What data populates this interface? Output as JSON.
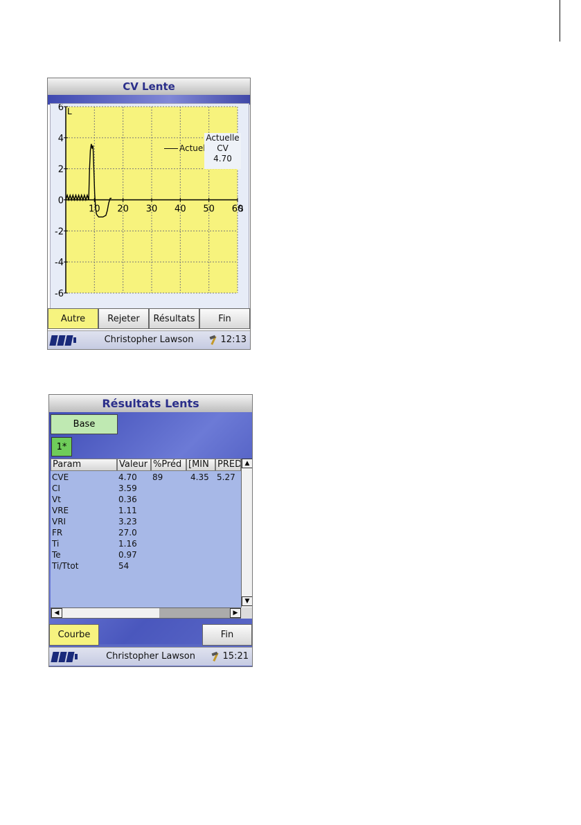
{
  "screen1": {
    "title": "CV Lente",
    "legend": {
      "series_label": "Actuell",
      "box_line1": "Actuelle",
      "box_line2": "CV",
      "box_value": "4.70"
    },
    "buttons": [
      "Autre",
      "Rejeter",
      "Résultats",
      "Fin"
    ],
    "active_button": "Autre",
    "status": {
      "user": "Christopher Lawson",
      "time": "12:13"
    }
  },
  "chart_data": {
    "type": "line",
    "y_unit": "L",
    "x_unit": "S",
    "xlim": [
      0,
      60
    ],
    "ylim": [
      -6,
      6
    ],
    "x_ticks": [
      10,
      20,
      30,
      40,
      50,
      60
    ],
    "y_ticks": [
      6,
      4,
      2,
      0,
      -2,
      -4,
      -6
    ],
    "x_tick_labels": [
      "10",
      "20",
      "30",
      "40",
      "50",
      "60"
    ],
    "y_tick_labels": [
      "6",
      "4",
      "2",
      "0",
      "-2",
      "-4",
      "-6"
    ],
    "grid": true,
    "legend_position": "top-right",
    "series": [
      {
        "name": "Actuell",
        "color": "#000000",
        "x": [
          0,
          0.5,
          1,
          1.5,
          2,
          2.5,
          3,
          3.5,
          4,
          4.5,
          5,
          5.5,
          6,
          6.5,
          7,
          7.5,
          8,
          8.3,
          8.6,
          8.9,
          9.2,
          9.5,
          9.8,
          10.1,
          10.4,
          10.7,
          11,
          11.5,
          12,
          13,
          14,
          14.5,
          15,
          15.5,
          16
        ],
        "y": [
          0,
          0.3,
          0,
          0.3,
          0,
          0.3,
          0,
          0.3,
          0,
          0.3,
          0,
          0.3,
          0,
          0.3,
          0,
          0.3,
          0,
          2.0,
          3.2,
          3.6,
          3.3,
          3.5,
          2.0,
          0.4,
          -0.5,
          -0.9,
          -1.0,
          -1.1,
          -1.1,
          -1.1,
          -1.0,
          -0.7,
          -0.2,
          0.1,
          0.1
        ]
      }
    ]
  },
  "screen2": {
    "title": "Résultats Lents",
    "base_button": "Base",
    "tab": "1*",
    "columns": [
      "Param",
      "Valeur",
      "%Préd",
      "[MIN",
      "PRED"
    ],
    "rows": [
      [
        "CVE",
        "4.70",
        "89",
        "4.35",
        "5.27"
      ],
      [
        "CI",
        "3.59",
        "",
        "",
        ""
      ],
      [
        "Vt",
        "0.36",
        "",
        "",
        ""
      ],
      [
        "VRE",
        "1.11",
        "",
        "",
        ""
      ],
      [
        "VRI",
        "3.23",
        "",
        "",
        ""
      ],
      [
        "FR",
        "27.0",
        "",
        "",
        ""
      ],
      [
        "Ti",
        "1.16",
        "",
        "",
        ""
      ],
      [
        "Te",
        "0.97",
        "",
        "",
        ""
      ],
      [
        "Ti/Ttot",
        "54",
        "",
        "",
        ""
      ]
    ],
    "buttons": {
      "left": "Courbe",
      "right": "Fin"
    },
    "status": {
      "user": "Christopher Lawson",
      "time": "15:21"
    }
  },
  "colors": {
    "chart_bg": "#f7f37d",
    "grid": "#7a7a7a",
    "title_text": "#2b2f8a",
    "active_button": "#f6f37f",
    "base_button": "#bfe9b2",
    "tab_active": "#6fcc5a",
    "table_bg": "#a7b8e7",
    "battery": "#1a2a7a"
  },
  "icons": [
    "battery-icon",
    "tools-icon",
    "scroll-up-icon",
    "scroll-down-icon",
    "scroll-left-icon",
    "scroll-right-icon"
  ]
}
